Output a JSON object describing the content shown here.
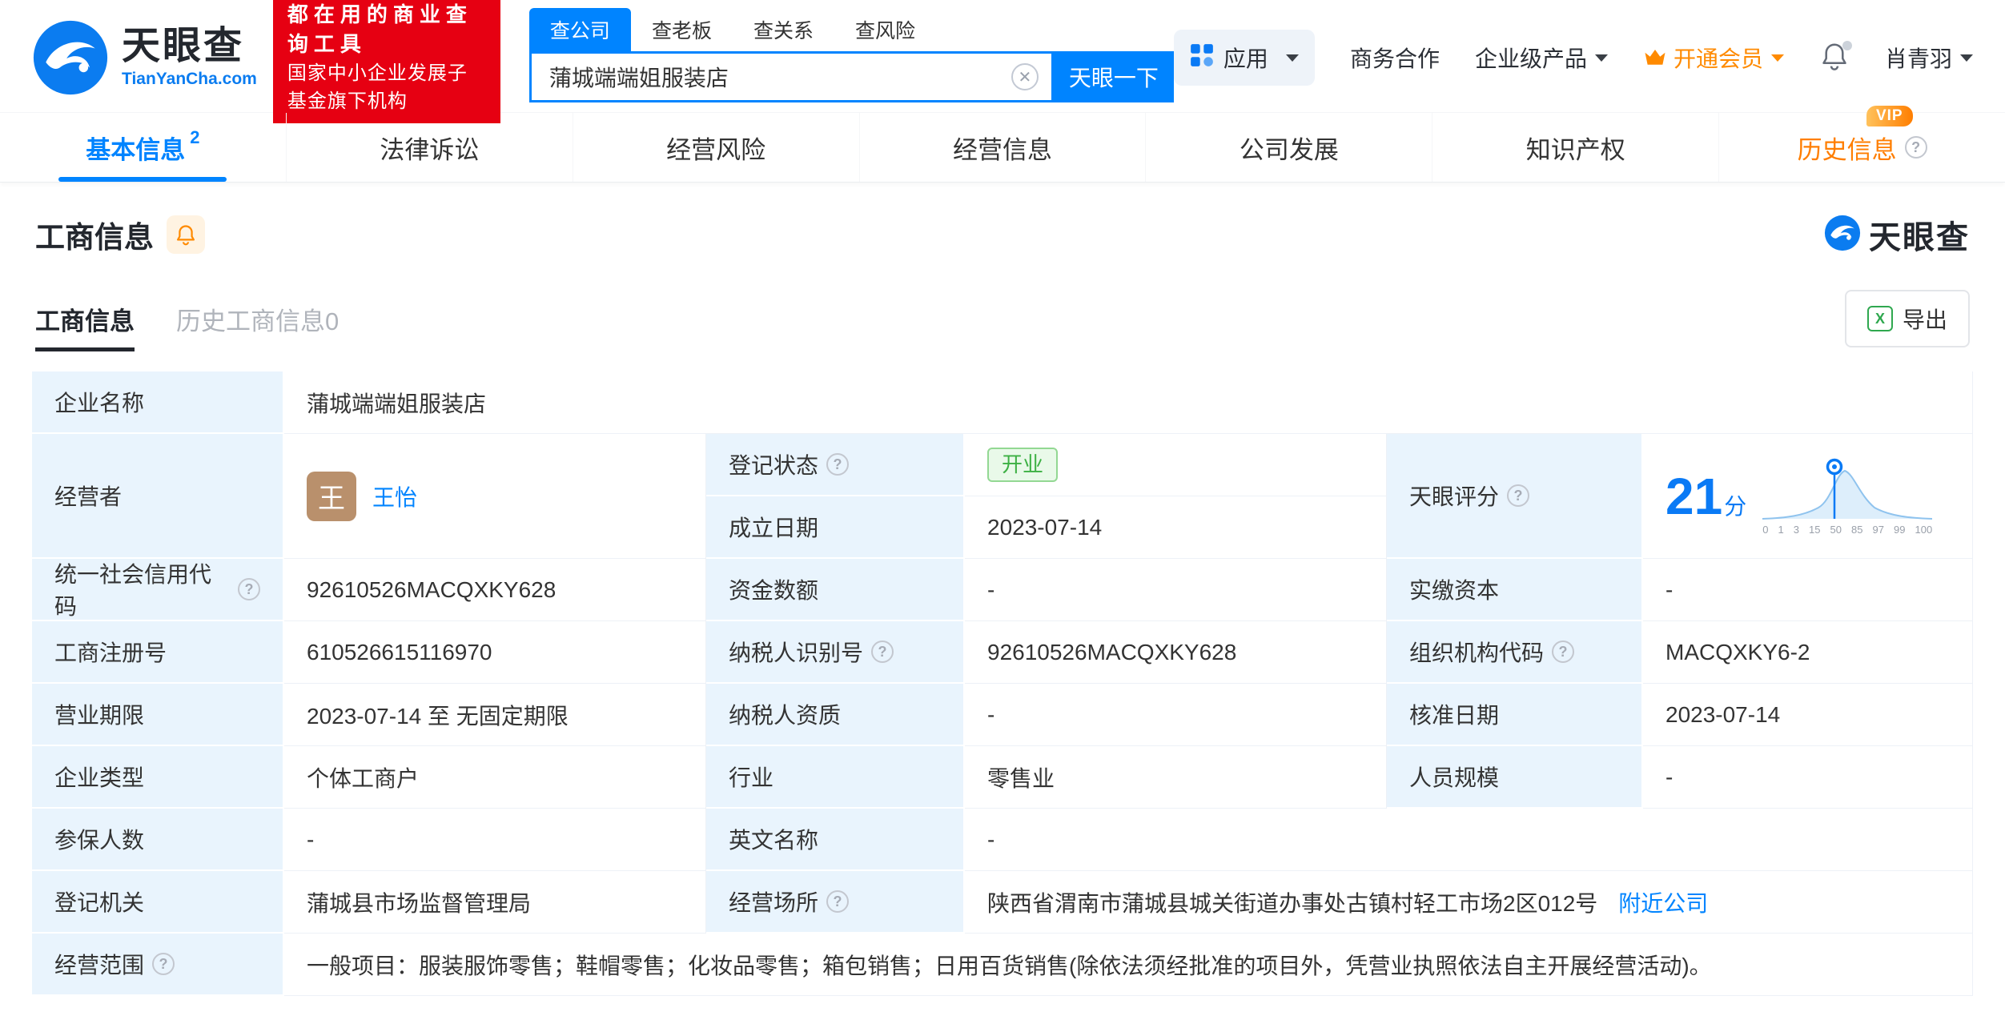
{
  "brand": {
    "name": "天眼查",
    "domain": "TianYanCha.com",
    "slogan_line1": "都在用的商业查询工具",
    "slogan_line2": "国家中小企业发展子基金旗下机构"
  },
  "search": {
    "tabs": [
      "查公司",
      "查老板",
      "查关系",
      "查风险"
    ],
    "value": "蒲城端端姐服装店",
    "button": "天眼一下"
  },
  "nav_right": {
    "apps": "应用",
    "biz": "商务合作",
    "enterprise": "企业级产品",
    "member": "开通会员",
    "user": "肖青羽"
  },
  "main_tabs": [
    {
      "label": "基本信息",
      "count": "2"
    },
    {
      "label": "法律诉讼"
    },
    {
      "label": "经营风险"
    },
    {
      "label": "经营信息"
    },
    {
      "label": "公司发展"
    },
    {
      "label": "知识产权"
    },
    {
      "label": "历史信息",
      "tag": "VIP"
    }
  ],
  "section": {
    "title": "工商信息",
    "logo": "天眼查",
    "subtab_active": "工商信息",
    "subtab_history": "历史工商信息0",
    "export": "导出"
  },
  "score": {
    "value": "21",
    "unit": "分",
    "ticks": [
      "0",
      "1",
      "3",
      "15",
      "50",
      "85",
      "97",
      "99",
      "100"
    ]
  },
  "fields": {
    "name_label": "企业名称",
    "name": "蒲城端端姐服装店",
    "operator_label": "经营者",
    "operator_avatar": "王",
    "operator_name": "王怡",
    "reg_status_label": "登记状态",
    "reg_status": "开业",
    "establish_label": "成立日期",
    "establish_date": "2023-07-14",
    "score_label": "天眼评分",
    "credit_code_label": "统一社会信用代码",
    "credit_code": "92610526MACQXKY628",
    "capital_label": "资金数额",
    "capital": "-",
    "paid_capital_label": "实缴资本",
    "paid_capital": "-",
    "reg_number_label": "工商注册号",
    "reg_number": "610526615116970",
    "taxpayer_id_label": "纳税人识别号",
    "taxpayer_id": "92610526MACQXKY628",
    "org_code_label": "组织机构代码",
    "org_code": "MACQXKY6-2",
    "term_label": "营业期限",
    "term": "2023-07-14 至 无固定期限",
    "taxpayer_quality_label": "纳税人资质",
    "taxpayer_quality": "-",
    "approval_label": "核准日期",
    "approval_date": "2023-07-14",
    "type_label": "企业类型",
    "type": "个体工商户",
    "industry_label": "行业",
    "industry": "零售业",
    "staff_label": "人员规模",
    "staff": "-",
    "insured_label": "参保人数",
    "insured": "-",
    "english_label": "英文名称",
    "english_name": "-",
    "registry_label": "登记机关",
    "registry": "蒲城县市场监督管理局",
    "premises_label": "经营场所",
    "premises": "陕西省渭南市蒲城县城关街道办事处古镇村轻工市场2区012号",
    "nearby_link": "附近公司",
    "scope_label": "经营范围",
    "scope": "一般项目：服装服饰零售；鞋帽零售；化妆品零售；箱包销售；日用百货销售(除依法须经批准的项目外，凭营业执照依法自主开展经营活动)。"
  }
}
